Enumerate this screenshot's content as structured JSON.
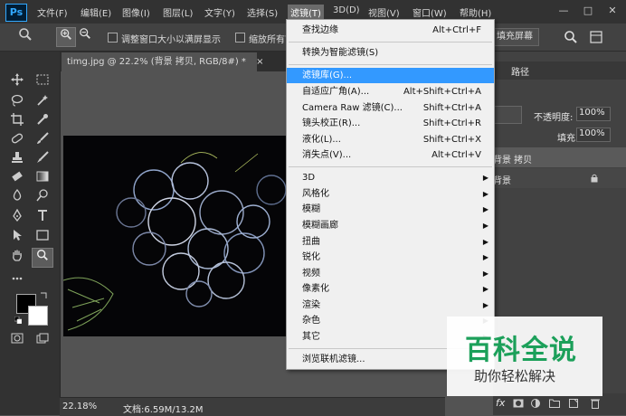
{
  "menubar": {
    "logo": "Ps",
    "items": [
      "文件(F)",
      "编辑(E)",
      "图像(I)",
      "图层(L)",
      "文字(Y)",
      "选择(S)",
      "滤镜(T)",
      "3D(D)",
      "视图(V)",
      "窗口(W)",
      "帮助(H)"
    ],
    "window_buttons": {
      "minimize": "—",
      "restore": "□",
      "close": "✕"
    }
  },
  "options": {
    "zoom_glyph": "🔍",
    "checkbox1_label": "调整窗口大小以满屏显示",
    "checkbox2_label": "缩放所有窗",
    "fill_screen_label": "填充屏幕"
  },
  "document": {
    "tab_title": "timg.jpg @ 22.2% (背景 拷贝, RGB/8#) *",
    "tab_close": "×",
    "zoom_status": "22.18%",
    "doc_info": "文档:6.59M/13.2M"
  },
  "panels": {
    "paths_tab": "路径",
    "opacity_label": "不透明度:",
    "opacity_value": "100%",
    "fill_label": "填充:",
    "fill_value": "100%",
    "layers": [
      "背景 拷贝",
      "背景"
    ]
  },
  "filter_menu": {
    "items": [
      {
        "label": "查找边缘",
        "shortcut": "Alt+Ctrl+F"
      },
      {
        "label": "转换为智能滤镜(S)",
        "shortcut": ""
      },
      {
        "label": "滤镜库(G)...",
        "shortcut": ""
      },
      {
        "label": "自适应广角(A)...",
        "shortcut": "Alt+Shift+Ctrl+A"
      },
      {
        "label": "Camera Raw 滤镜(C)...",
        "shortcut": "Shift+Ctrl+A"
      },
      {
        "label": "镜头校正(R)...",
        "shortcut": "Shift+Ctrl+R"
      },
      {
        "label": "液化(L)...",
        "shortcut": "Shift+Ctrl+X"
      },
      {
        "label": "消失点(V)...",
        "shortcut": "Alt+Ctrl+V"
      },
      {
        "label": "3D",
        "shortcut": ""
      },
      {
        "label": "风格化",
        "shortcut": ""
      },
      {
        "label": "模糊",
        "shortcut": ""
      },
      {
        "label": "模糊画廊",
        "shortcut": ""
      },
      {
        "label": "扭曲",
        "shortcut": ""
      },
      {
        "label": "锐化",
        "shortcut": ""
      },
      {
        "label": "视频",
        "shortcut": ""
      },
      {
        "label": "像素化",
        "shortcut": ""
      },
      {
        "label": "渲染",
        "shortcut": ""
      },
      {
        "label": "杂色",
        "shortcut": ""
      },
      {
        "label": "其它",
        "shortcut": ""
      },
      {
        "label": "浏览联机滤镜...",
        "shortcut": ""
      }
    ],
    "submenu_arrow": "▶"
  },
  "watermark": {
    "title": "百科全说",
    "subtitle": "助你轻松解决"
  },
  "colors": {
    "accent": "#3399ff",
    "watermark_green": "#1ca05a"
  }
}
